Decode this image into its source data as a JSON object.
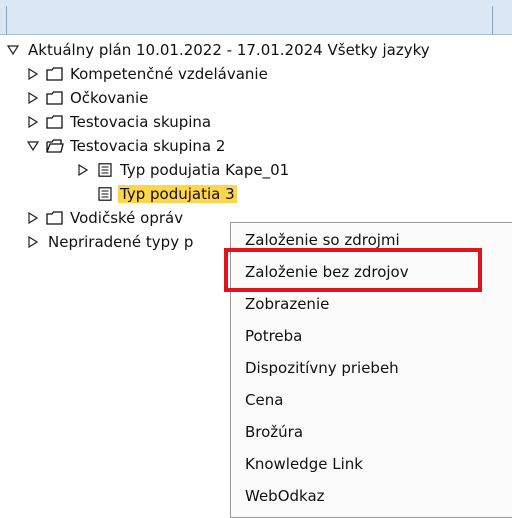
{
  "tree": {
    "root_label": "Aktuálny plán 10.01.2022 - 17.01.2024 Všetky jazyky",
    "items": [
      {
        "label": "Kompetenčné vzdelávanie"
      },
      {
        "label": "Očkovanie"
      },
      {
        "label": "Testovacia skupina"
      },
      {
        "label": "Testovacia skupina 2"
      },
      {
        "label": "Typ podujatia Kape_01"
      },
      {
        "label": "Typ podujatia 3"
      },
      {
        "label": "Vodičské opráv"
      },
      {
        "label": "Nepriradené typy p"
      }
    ]
  },
  "context_menu": {
    "items": [
      {
        "label": "Založenie so zdrojmi"
      },
      {
        "label": "Založenie bez zdrojov"
      },
      {
        "label": "Zobrazenie"
      },
      {
        "label": "Potreba"
      },
      {
        "label": "Dispozitívny priebeh"
      },
      {
        "label": "Cena"
      },
      {
        "label": "Brožúra"
      },
      {
        "label": "Knowledge Link"
      },
      {
        "label": "WebOdkaz"
      }
    ],
    "highlighted_item": "Založenie bez zdrojov"
  },
  "colors": {
    "selection": "#ffd54a",
    "highlight_box": "#e3121b"
  }
}
